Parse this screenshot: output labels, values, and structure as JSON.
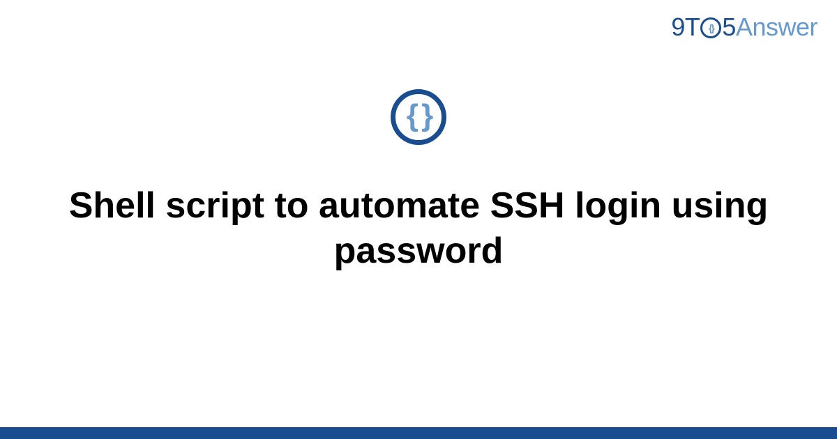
{
  "logo": {
    "part1": "9T",
    "inner_braces": "{}",
    "part2": "5",
    "part3": "Answer"
  },
  "center": {
    "braces": "{ }"
  },
  "title": "Shell script to automate SSH login using password",
  "colors": {
    "primary": "#1a4d8f",
    "secondary": "#6699cc",
    "text": "#000000",
    "background": "#ffffff"
  }
}
